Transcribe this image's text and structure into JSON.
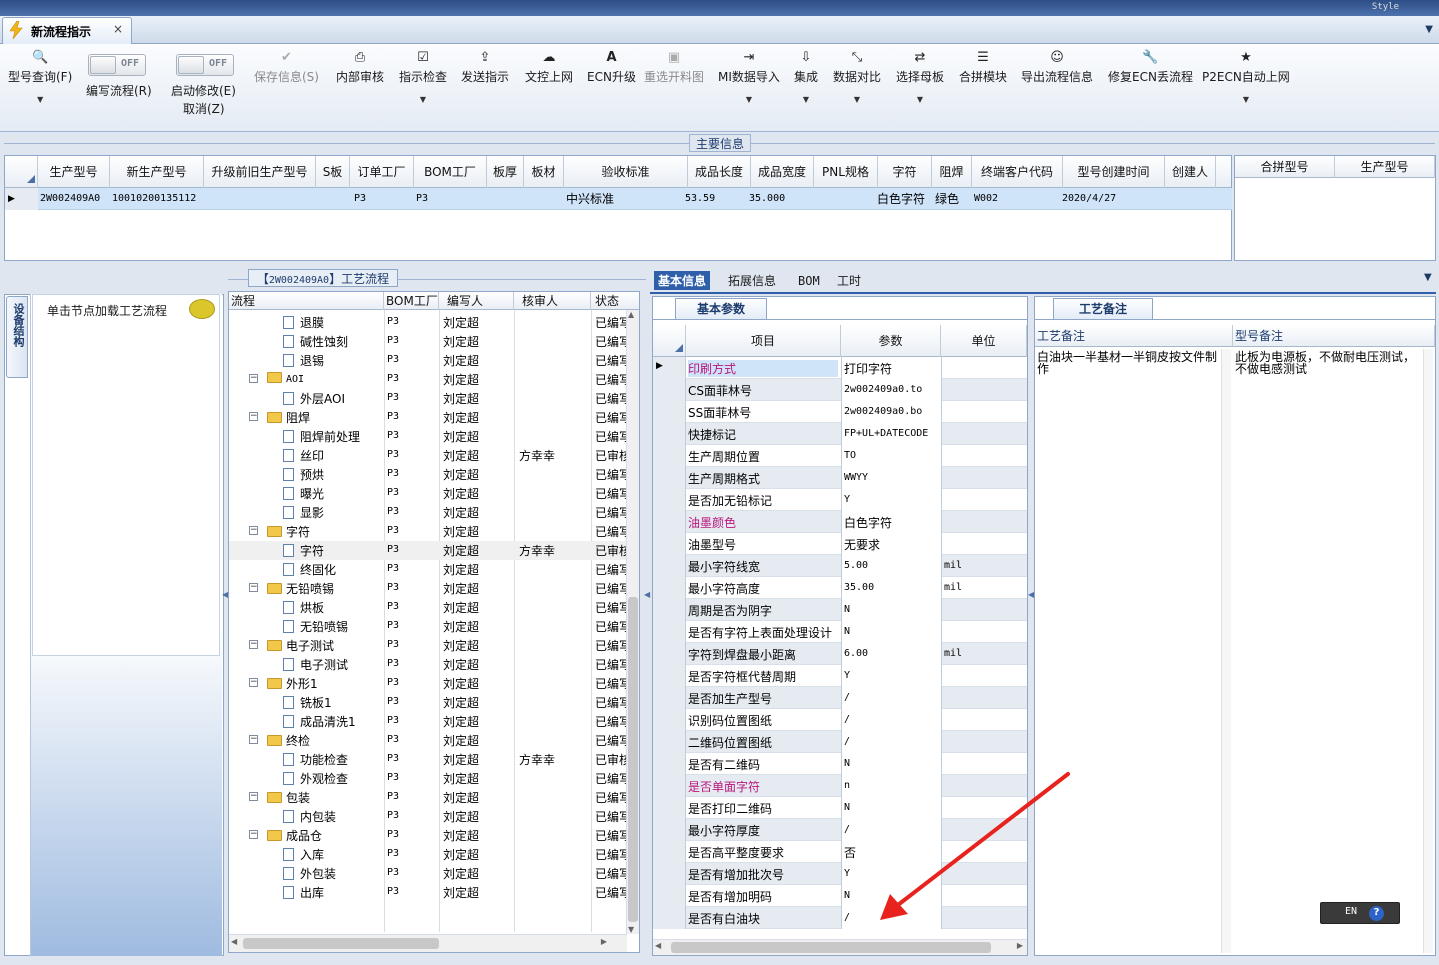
{
  "window": {
    "style_label": "Style"
  },
  "doc_tab": {
    "title": "新流程指示",
    "close": "×"
  },
  "ribbon": {
    "buttons": [
      {
        "label": "型号查询(F)",
        "icon": "search-icon"
      },
      {
        "label": "编写流程(R)"
      },
      {
        "label": "启动修改(E)",
        "sub": "取消(Z)"
      },
      {
        "label": "保存信息(S)",
        "icon": "check-icon"
      },
      {
        "label": "内部审核",
        "icon": "printer-icon"
      },
      {
        "label": "指示检查",
        "icon": "checkbox-icon"
      },
      {
        "label": "发送指示",
        "icon": "upload-icon"
      },
      {
        "label": "文控上网",
        "icon": "cloud-upload-icon"
      },
      {
        "label": "ECN升级",
        "icon": "font-icon"
      },
      {
        "label": "重选开料图",
        "icon": "image-icon"
      },
      {
        "label": "MI数据导入",
        "icon": "import-icon"
      },
      {
        "label": "集成",
        "icon": "download-icon"
      },
      {
        "label": "数据对比",
        "icon": "compress-icon"
      },
      {
        "label": "选择母板",
        "icon": "shuffle-icon"
      },
      {
        "label": "合拼模块",
        "icon": "list-icon"
      },
      {
        "label": "导出流程信息",
        "icon": "smile-icon"
      },
      {
        "label": "修复ECN丢流程",
        "icon": "wrench-icon"
      },
      {
        "label": "P2ECN自动上网",
        "icon": "star-icon"
      }
    ],
    "toggle_off": "OFF"
  },
  "main_info": {
    "title": "主要信息",
    "columns": [
      "生产型号",
      "新生产型号",
      "升级前旧生产型号",
      "S板",
      "订单工厂",
      "BOM工厂",
      "板厚",
      "板材",
      "验收标准",
      "成品长度",
      "成品宽度",
      "PNL规格",
      "字符",
      "阻焊",
      "终端客户代码",
      "型号创建时间",
      "创建人"
    ],
    "row": {
      "生产型号": "2W002409A0",
      "新生产型号": "10010200135112",
      "订单工厂": "P3",
      "BOM工厂": "P3",
      "验收标准": "中兴标准",
      "成品长度": "53.59",
      "成品宽度": "35.000",
      "字符": "白色字符",
      "阻焊": "绿色",
      "终端客户代码": "W002",
      "型号创建时间": "2020/4/27"
    },
    "side_columns": [
      "合拼型号",
      "生产型号"
    ]
  },
  "left": {
    "vtab": "设备结构",
    "nav_label": "单击节点加载工艺流程"
  },
  "flow": {
    "title_code": "2W002409A0",
    "title_text": "工艺流程",
    "columns": [
      "流程",
      "BOM工厂",
      "编写人",
      "核审人",
      "状态"
    ],
    "rows": [
      {
        "name": "退膜",
        "level": 2,
        "factory": "P3",
        "author": "刘定超",
        "reviewer": "",
        "status": "已编写"
      },
      {
        "name": "碱性蚀刻",
        "level": 2,
        "factory": "P3",
        "author": "刘定超",
        "reviewer": "",
        "status": "已编写"
      },
      {
        "name": "退锡",
        "level": 2,
        "factory": "P3",
        "author": "刘定超",
        "reviewer": "",
        "status": "已编写"
      },
      {
        "name": "AOI",
        "level": 1,
        "factory": "P3",
        "author": "刘定超",
        "reviewer": "",
        "status": "已编写"
      },
      {
        "name": "外层AOI",
        "level": 2,
        "factory": "P3",
        "author": "刘定超",
        "reviewer": "",
        "status": "已编写"
      },
      {
        "name": "阻焊",
        "level": 1,
        "factory": "P3",
        "author": "刘定超",
        "reviewer": "",
        "status": "已编写"
      },
      {
        "name": "阻焊前处理",
        "level": 2,
        "factory": "P3",
        "author": "刘定超",
        "reviewer": "",
        "status": "已编写"
      },
      {
        "name": "丝印",
        "level": 2,
        "factory": "P3",
        "author": "刘定超",
        "reviewer": "方幸幸",
        "status": "已审核"
      },
      {
        "name": "预烘",
        "level": 2,
        "factory": "P3",
        "author": "刘定超",
        "reviewer": "",
        "status": "已编写"
      },
      {
        "name": "曝光",
        "level": 2,
        "factory": "P3",
        "author": "刘定超",
        "reviewer": "",
        "status": "已编写"
      },
      {
        "name": "显影",
        "level": 2,
        "factory": "P3",
        "author": "刘定超",
        "reviewer": "",
        "status": "已编写"
      },
      {
        "name": "字符",
        "level": 1,
        "factory": "P3",
        "author": "刘定超",
        "reviewer": "",
        "status": "已编写"
      },
      {
        "name": "字符",
        "level": 2,
        "factory": "P3",
        "author": "刘定超",
        "reviewer": "方幸幸",
        "status": "已审核",
        "selected": true
      },
      {
        "name": "终固化",
        "level": 2,
        "factory": "P3",
        "author": "刘定超",
        "reviewer": "",
        "status": "已编写"
      },
      {
        "name": "无铅喷锡",
        "level": 1,
        "factory": "P3",
        "author": "刘定超",
        "reviewer": "",
        "status": "已编写"
      },
      {
        "name": "烘板",
        "level": 2,
        "factory": "P3",
        "author": "刘定超",
        "reviewer": "",
        "status": "已编写"
      },
      {
        "name": "无铅喷锡",
        "level": 2,
        "factory": "P3",
        "author": "刘定超",
        "reviewer": "",
        "status": "已编写"
      },
      {
        "name": "电子测试",
        "level": 1,
        "factory": "P3",
        "author": "刘定超",
        "reviewer": "",
        "status": "已编写"
      },
      {
        "name": "电子测试",
        "level": 2,
        "factory": "P3",
        "author": "刘定超",
        "reviewer": "",
        "status": "已编写"
      },
      {
        "name": "外形1",
        "level": 1,
        "factory": "P3",
        "author": "刘定超",
        "reviewer": "",
        "status": "已编写"
      },
      {
        "name": "铣板1",
        "level": 2,
        "factory": "P3",
        "author": "刘定超",
        "reviewer": "",
        "status": "已编写"
      },
      {
        "name": "成品清洗1",
        "level": 2,
        "factory": "P3",
        "author": "刘定超",
        "reviewer": "",
        "status": "已编写"
      },
      {
        "name": "终检",
        "level": 1,
        "factory": "P3",
        "author": "刘定超",
        "reviewer": "",
        "status": "已编写"
      },
      {
        "name": "功能检查",
        "level": 2,
        "factory": "P3",
        "author": "刘定超",
        "reviewer": "方幸幸",
        "status": "已审核"
      },
      {
        "name": "外观检查",
        "level": 2,
        "factory": "P3",
        "author": "刘定超",
        "reviewer": "",
        "status": "已编写"
      },
      {
        "name": "包装",
        "level": 1,
        "factory": "P3",
        "author": "刘定超",
        "reviewer": "",
        "status": "已编写"
      },
      {
        "name": "内包装",
        "level": 2,
        "factory": "P3",
        "author": "刘定超",
        "reviewer": "",
        "status": "已编写"
      },
      {
        "name": "成品仓",
        "level": 1,
        "factory": "P3",
        "author": "刘定超",
        "reviewer": "",
        "status": "已编写"
      },
      {
        "name": "入库",
        "level": 2,
        "factory": "P3",
        "author": "刘定超",
        "reviewer": "",
        "status": "已编写"
      },
      {
        "name": "外包装",
        "level": 2,
        "factory": "P3",
        "author": "刘定超",
        "reviewer": "",
        "status": "已编写"
      },
      {
        "name": "出库",
        "level": 2,
        "factory": "P3",
        "author": "刘定超",
        "reviewer": "",
        "status": "已编写"
      }
    ]
  },
  "right_tabs": [
    "基本信息",
    "拓展信息",
    "BOM",
    "工时"
  ],
  "basic": {
    "panel_title": "基本参数",
    "columns": [
      "项目",
      "参数",
      "单位"
    ],
    "rows": [
      {
        "item": "印刷方式",
        "value": "打印字符",
        "unit": "",
        "pink": true,
        "selected": true
      },
      {
        "item": "CS面菲林号",
        "value": "2w002409a0.to",
        "unit": ""
      },
      {
        "item": "SS面菲林号",
        "value": "2w002409a0.bo",
        "unit": ""
      },
      {
        "item": "快捷标记",
        "value": "FP+UL+DATECODE",
        "unit": ""
      },
      {
        "item": "生产周期位置",
        "value": "TO",
        "unit": ""
      },
      {
        "item": "生产周期格式",
        "value": "WWYY",
        "unit": ""
      },
      {
        "item": "是否加无铅标记",
        "value": "Y",
        "unit": ""
      },
      {
        "item": "油墨颜色",
        "value": "白色字符",
        "unit": "",
        "pink": true
      },
      {
        "item": "油墨型号",
        "value": "无要求",
        "unit": ""
      },
      {
        "item": "最小字符线宽",
        "value": "5.00",
        "unit": "mil"
      },
      {
        "item": "最小字符高度",
        "value": "35.00",
        "unit": "mil"
      },
      {
        "item": "周期是否为阴字",
        "value": "N",
        "unit": ""
      },
      {
        "item": "是否有字符上表面处理设计",
        "value": "N",
        "unit": ""
      },
      {
        "item": "字符到焊盘最小距离",
        "value": "6.00",
        "unit": "mil"
      },
      {
        "item": "是否字符框代替周期",
        "value": "Y",
        "unit": ""
      },
      {
        "item": "是否加生产型号",
        "value": "/",
        "unit": ""
      },
      {
        "item": "识别码位置图纸",
        "value": "/",
        "unit": ""
      },
      {
        "item": "二维码位置图纸",
        "value": "/",
        "unit": ""
      },
      {
        "item": "是否有二维码",
        "value": "N",
        "unit": ""
      },
      {
        "item": "是否单面字符",
        "value": "n",
        "unit": "",
        "pink": true
      },
      {
        "item": "是否打印二维码",
        "value": "N",
        "unit": ""
      },
      {
        "item": "最小字符厚度",
        "value": "/",
        "unit": ""
      },
      {
        "item": "是否高平整度要求",
        "value": "否",
        "unit": ""
      },
      {
        "item": "是否有增加批次号",
        "value": "Y",
        "unit": ""
      },
      {
        "item": "是否有增加明码",
        "value": "N",
        "unit": ""
      },
      {
        "item": "是否有白油块",
        "value": "/",
        "unit": ""
      }
    ]
  },
  "notes": {
    "panel_title": "工艺备注",
    "col1": "工艺备注",
    "col2": "型号备注",
    "text1": "白油块一半基材一半铜皮按文件制作",
    "text2": "此板为电源板，不做耐电压测试，不做电感测试"
  },
  "ime": {
    "label": "EN",
    "help": "?"
  },
  "colors": {
    "accent": "#2f5fa8",
    "selection": "#cfe3f9",
    "pink": "#b8167b",
    "annotation_arrow": "#e8231d"
  }
}
